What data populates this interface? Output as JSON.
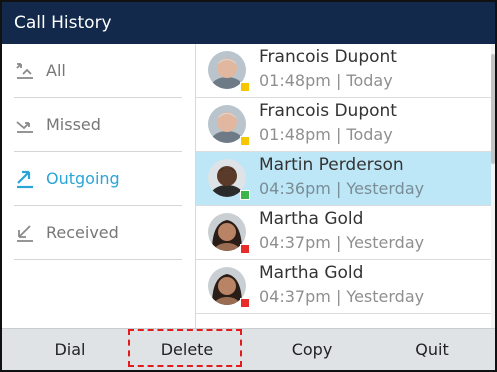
{
  "window": {
    "title": "Call History"
  },
  "filters": [
    {
      "label": "All",
      "icon": "all-calls-icon",
      "active": false
    },
    {
      "label": "Missed",
      "icon": "missed-call-icon",
      "active": false
    },
    {
      "label": "Outgoing",
      "icon": "outgoing-call-icon",
      "active": true
    },
    {
      "label": "Received",
      "icon": "received-call-icon",
      "active": false
    }
  ],
  "calls": [
    {
      "name": "Francois Dupont",
      "meta": "01:48pm | Today",
      "presence": "away",
      "presence_color": "#f6c600",
      "selected": false
    },
    {
      "name": "Francois Dupont",
      "meta": "01:48pm | Today",
      "presence": "away",
      "presence_color": "#f6c600",
      "selected": false
    },
    {
      "name": "Martin Perderson",
      "meta": "04:36pm | Yesterday",
      "presence": "available",
      "presence_color": "#3bb54a",
      "selected": true
    },
    {
      "name": "Martha Gold",
      "meta": "04:37pm | Yesterday",
      "presence": "busy",
      "presence_color": "#e82c2c",
      "selected": false
    },
    {
      "name": "Martha Gold",
      "meta": "04:37pm | Yesterday",
      "presence": "busy",
      "presence_color": "#e82c2c",
      "selected": false
    }
  ],
  "softkeys": {
    "dial": "Dial",
    "delete": "Delete",
    "copy": "Copy",
    "quit": "Quit"
  },
  "colors": {
    "titlebar": "#13294b",
    "accent": "#2aa5d8",
    "selected_row": "#bde7f7",
    "highlight": "#e41b1b"
  }
}
